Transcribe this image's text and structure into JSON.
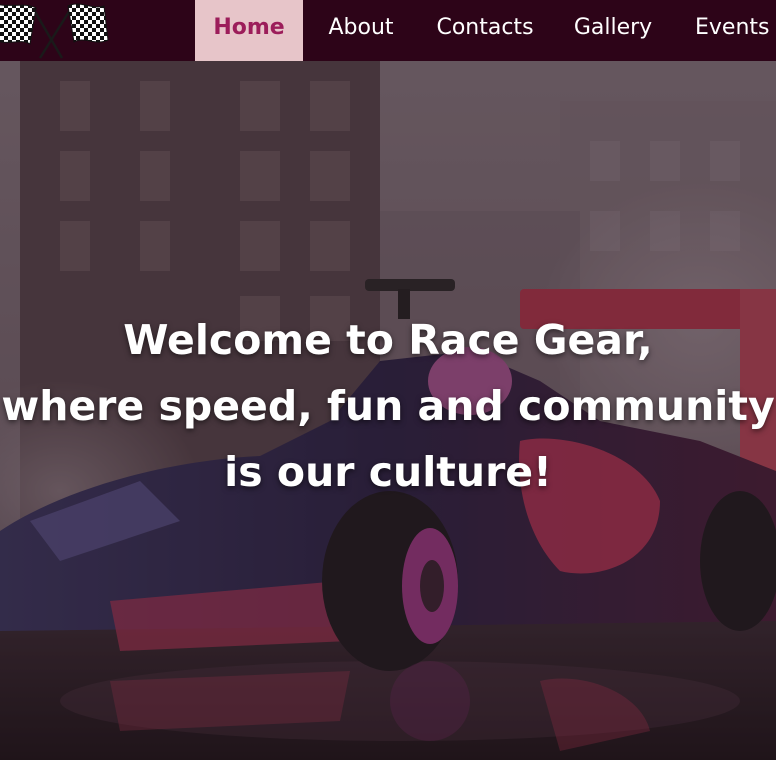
{
  "nav": {
    "logo_icon": "checkered-flags-icon",
    "items": [
      {
        "label": "Home",
        "active": true
      },
      {
        "label": "About"
      },
      {
        "label": "Contacts"
      },
      {
        "label": "Gallery"
      },
      {
        "label": "Events"
      }
    ]
  },
  "hero": {
    "image": "race-car-hero-image",
    "headline_lines": [
      "Welcome to Race Gear,",
      "where speed, fun and community",
      "is our culture!"
    ]
  },
  "colors": {
    "nav_bg": "#2d0418",
    "nav_active_bg": "#e7c5c9",
    "nav_active_text": "#9c1d5a",
    "nav_text": "#ffffff",
    "headline_text": "#ffffff"
  }
}
